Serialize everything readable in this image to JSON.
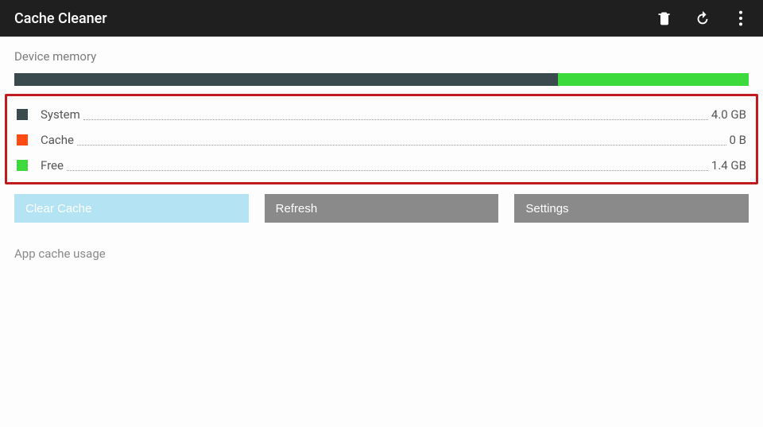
{
  "actionbar": {
    "title": "Cache Cleaner"
  },
  "memory": {
    "section_label": "Device memory",
    "bar": {
      "used_pct": 74,
      "free_pct": 26
    },
    "legend": [
      {
        "key": "system",
        "label": "System",
        "value": "4.0 GB",
        "swatch": "sw-system"
      },
      {
        "key": "cache",
        "label": "Cache",
        "value": "0 B",
        "swatch": "sw-cache"
      },
      {
        "key": "free",
        "label": "Free",
        "value": "1.4 GB",
        "swatch": "sw-free"
      }
    ]
  },
  "buttons": {
    "clear": "Clear Cache",
    "refresh": "Refresh",
    "settings": "Settings"
  },
  "app_cache": {
    "section_label": "App cache usage"
  },
  "chart_data": {
    "type": "bar",
    "title": "Device memory",
    "series": [
      {
        "name": "System",
        "value_label": "4.0 GB",
        "value_gb": 4.0
      },
      {
        "name": "Cache",
        "value_label": "0 B",
        "value_gb": 0.0
      },
      {
        "name": "Free",
        "value_label": "1.4 GB",
        "value_gb": 1.4
      }
    ],
    "total_gb": 5.4
  }
}
